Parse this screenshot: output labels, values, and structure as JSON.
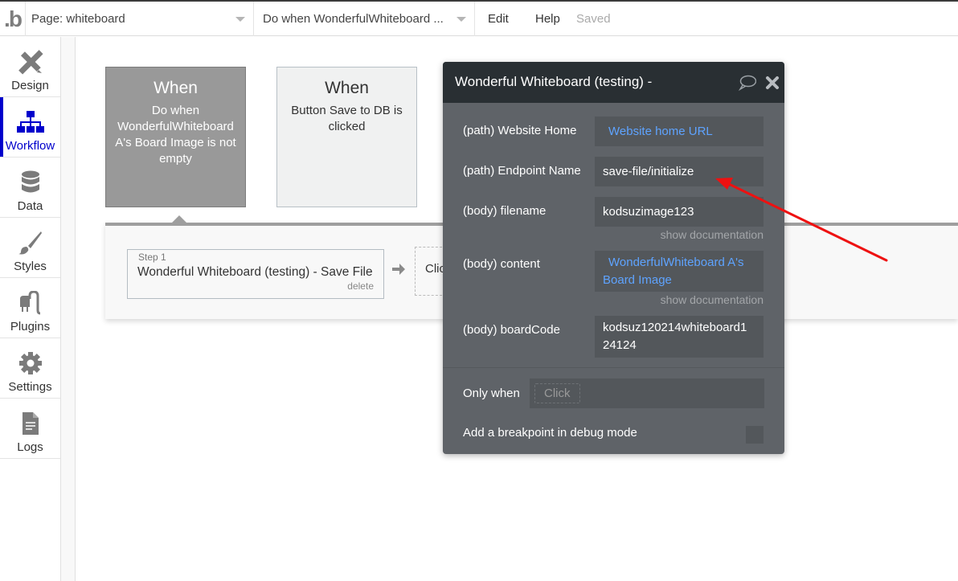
{
  "topbar": {
    "logo": ".b",
    "page_dropdown": "Page: whiteboard",
    "workflow_dropdown": "Do when WonderfulWhiteboard ...",
    "menu_edit": "Edit",
    "menu_help": "Help",
    "save_status": "Saved"
  },
  "sidebar": {
    "items": [
      {
        "label": "Design",
        "icon": "design-icon"
      },
      {
        "label": "Workflow",
        "icon": "workflow-icon",
        "active": true
      },
      {
        "label": "Data",
        "icon": "database-icon"
      },
      {
        "label": "Styles",
        "icon": "brush-icon"
      },
      {
        "label": "Plugins",
        "icon": "plug-icon"
      },
      {
        "label": "Settings",
        "icon": "gear-icon"
      },
      {
        "label": "Logs",
        "icon": "document-icon"
      }
    ]
  },
  "events": [
    {
      "heading": "When",
      "description": "Do when WonderfulWhiteboard A's Board Image is not empty",
      "selected": true
    },
    {
      "heading": "When",
      "description": "Button Save to DB is clicked",
      "selected": false
    }
  ],
  "actions": {
    "step_label": "Step 1",
    "step_title": "Wonderful Whiteboard (testing) - Save File",
    "delete_label": "delete",
    "add_action_label": "Click"
  },
  "editor": {
    "title": "Wonderful Whiteboard (testing) -",
    "fields": [
      {
        "label": "(path) Website Home",
        "value": "Website home URL",
        "dynamic": true
      },
      {
        "label": "(path) Endpoint Name",
        "value": "save-file/initialize",
        "dynamic": false
      },
      {
        "label": "(body) filename",
        "value": "kodsuzimage123",
        "dynamic": false,
        "doc_link": "show documentation"
      },
      {
        "label": "(body) content",
        "value_line1": "WonderfulWhiteboard A's",
        "value_line2": "Board Image",
        "dynamic": true,
        "doc_link": "show documentation"
      },
      {
        "label": "(body) boardCode",
        "value_line1": "kodsuz120214whiteboard1",
        "value_line2": "24124",
        "dynamic": false
      }
    ],
    "only_when_label": "Only when",
    "only_when_placeholder": "Click",
    "breakpoint_label": "Add a breakpoint in debug mode",
    "breakpoint_checked": false
  },
  "colors": {
    "accent": "#0000cc",
    "dynamic_text": "#5ea3ff",
    "annotation_arrow": "#ee1111"
  }
}
